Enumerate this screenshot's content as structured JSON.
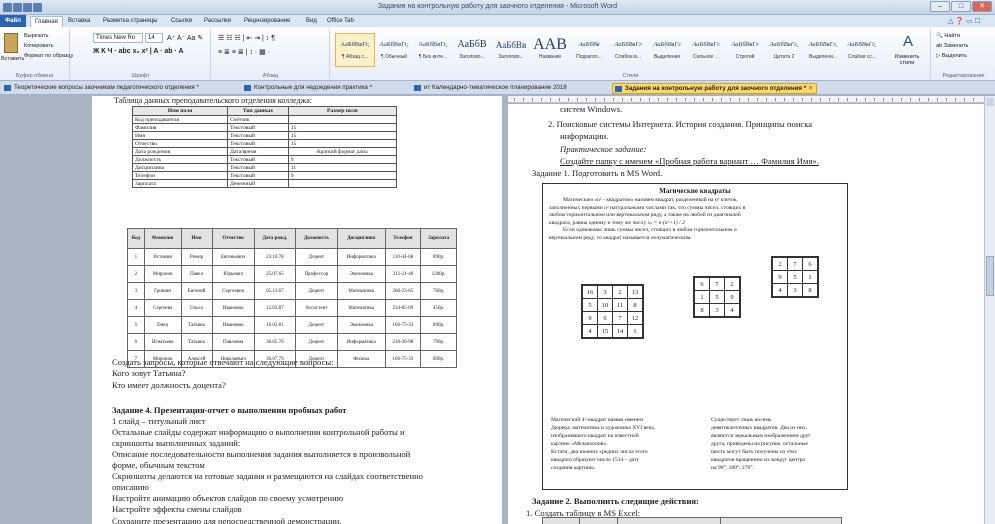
{
  "window": {
    "title": "Задания на контрольную работу для заочного отделения - Microsoft Word"
  },
  "ribbon_tabs": [
    "Файл",
    "Главная",
    "Вставка",
    "Разметка страницы",
    "Ссылки",
    "Рассылки",
    "Рецензирование",
    "Вид",
    "Office Tab"
  ],
  "clipboard": {
    "cut": "Вырезать",
    "copy": "Копировать",
    "paste": "Вставить",
    "format": "Формат по образцу",
    "group": "Буфер обмена"
  },
  "font": {
    "name": "Times New Ro",
    "size": "14",
    "group": "Шрифт"
  },
  "paragraph": {
    "group": "Абзац"
  },
  "styles": {
    "group": "Стили",
    "items": [
      {
        "sample": "АаБбВвГг,",
        "name": "¶ Абзац с..."
      },
      {
        "sample": "АаБбВвГг,",
        "name": "¶ Обычный"
      },
      {
        "sample": "АаБбВвГг,",
        "name": "¶ Без инте..."
      },
      {
        "sample": "АаБбВ",
        "name": "Заголово..."
      },
      {
        "sample": "АаБбВв",
        "name": "Заголово..."
      },
      {
        "sample": "ААВ",
        "name": "Название"
      },
      {
        "sample": "АаБбВв",
        "name": "Подзагол..."
      },
      {
        "sample": "АаБбВвГг",
        "name": "Слабое в..."
      },
      {
        "sample": "АаБбВвГг",
        "name": "Выделение"
      },
      {
        "sample": "АаБбВвГг",
        "name": "Сильное ..."
      },
      {
        "sample": "АаБбВвГг",
        "name": "Строгий"
      },
      {
        "sample": "АаБбВвГг,",
        "name": "Цитата 2"
      },
      {
        "sample": "АаБбВвГг,",
        "name": "Выделени..."
      },
      {
        "sample": "АаБбВвГг,",
        "name": "Слабая сс..."
      }
    ],
    "change": "Изменить стили"
  },
  "editing": {
    "find": "Найти",
    "replace": "Заменить",
    "select": "Выделить",
    "group": "Редактирование"
  },
  "doc_tabs": [
    {
      "label": "Теоретические вопросы заочникам педагогического отделения *",
      "active": false
    },
    {
      "label": "Контрольные для недоедения практика *",
      "active": false
    },
    {
      "label": "ит Календарно-тематическое планирование 2018",
      "active": false
    },
    {
      "label": "Задания на контрольную работу для заочного отделения *",
      "active": true
    }
  ],
  "left_page": {
    "caption": "Таблица данных преподавательского отделения колледжа:",
    "fields_header": [
      "Имя поля",
      "Тип данных",
      "Размер поля"
    ],
    "fields": [
      [
        "Код преподавателя",
        "Счетчик",
        ""
      ],
      [
        "Фамилия",
        "Текстовый",
        "15"
      ],
      [
        "Имя",
        "Текстовый",
        "15"
      ],
      [
        "Отчество",
        "Текстовый",
        "15"
      ],
      [
        "Дата рождения",
        "Дата/время",
        "Краткий формат даты"
      ],
      [
        "Должность",
        "Текстовый",
        "9"
      ],
      [
        "Дисциплина",
        "Текстовый",
        "11"
      ],
      [
        "Телефон",
        "Текстовый",
        "9"
      ],
      [
        "Зарплата",
        "Денежный",
        ""
      ]
    ],
    "data_header": [
      "Код",
      "Фамилия",
      "Имя",
      "Отчество",
      "Дата рожд.",
      "Должность",
      "Дисциплина",
      "Телефон",
      "Зарплата"
    ],
    "data_rows": [
      [
        "1",
        "Истомин",
        "Ремир",
        "Евгеньевич",
        "23.10.78",
        "Доцент",
        "Информатика",
        "110-44-68",
        "890р."
      ],
      [
        "2",
        "Миронов",
        "Павел",
        "Юрьевич",
        "25.07.65",
        "Профессор",
        "Экономика",
        "312-21-40",
        "1200р."
      ],
      [
        "3",
        "Гришин",
        "Евгений",
        "Сергеевич",
        "05.12.67",
        "Доцент",
        "Математика",
        "260-23-65",
        "760р."
      ],
      [
        "4",
        "Сергеева",
        "Ольга",
        "Ивановна",
        "12.02.87",
        "Ассистент",
        "Математика",
        "234-85-69",
        "450р."
      ],
      [
        "5",
        "Емец",
        "Татьяна",
        "Ивановна",
        "16.02.81",
        "Доцент",
        "Экономика",
        "166-75-33",
        "890р."
      ],
      [
        "6",
        "Игнатьева",
        "Татьяна",
        "Павловна",
        "30.05.76",
        "Доцент",
        "Информатика",
        "210-36-98",
        "790р."
      ],
      [
        "7",
        "Миронов",
        "Алексей",
        "Николаевич",
        "30.07.79",
        "Доцент",
        "Физика",
        "166-75-33",
        "890р."
      ]
    ],
    "lines": [
      "Создать запросы, которые отвечают на следующие вопросы:",
      "Кого зовут Татьяна?",
      "Кто имеет должность доцента?",
      "Задание 4. Презентация-отчет о выполнении пробных работ",
      "1 слайд – титульный лист",
      "Остальные слайды содержат информацию о выполнении контрольной работы и",
      "скриншоты выполненных заданий:",
      "Описание последовательности выполнения задания выполняется в произвольной",
      "форме, обычным текстом",
      "Скриншоты делаются на готовые задания и размещаются на слайдах соответственно",
      "описанию",
      "Настройте анимацию объектов слайдов по своему усмотрению",
      "Настройте эффекты смены слайдов",
      "Сохраните презентацию для непосредственной демонстрации."
    ]
  },
  "right_page": {
    "lines": [
      "систем Windows.",
      "2.  Поисковые системы Интернета. История создания. Принципы поиска",
      "информации.",
      "Практическое задание:",
      "Создайте папку с именем «Пробная работа вариант … Фамилия Имя».",
      "Задание 1. Подготовить в MS Word."
    ],
    "box": {
      "title": "Магические квадраты",
      "p1": "Магическим «n² - квадратом» назовем квадрат, разделенный на n² клеток,",
      "p2": "заполненных первыми n² натуральными числами так, что суммы чисел, стоящих в",
      "p3": "любом горизонтальном или вертикальном ряду, а также на любой из диагоналей",
      "p4": "квадрата, равны одному и тому же числу",
      "formula": "sₙ = n·(n²+1) / 2",
      "p5": "Если одинаковы лишь суммы чисел, стоящих в любом горизонтальном и",
      "p6": "вертикальном ряду, то квадрат называется полумагическим.",
      "sq4": [
        [
          "16",
          "3",
          "2",
          "13"
        ],
        [
          "5",
          "10",
          "11",
          "8"
        ],
        [
          "9",
          "6",
          "7",
          "12"
        ],
        [
          "4",
          "15",
          "14",
          "1"
        ]
      ],
      "sq3a": [
        [
          "6",
          "7",
          "2"
        ],
        [
          "1",
          "5",
          "9"
        ],
        [
          "8",
          "3",
          "4"
        ]
      ],
      "sq3b": [
        [
          "2",
          "7",
          "6"
        ],
        [
          "9",
          "5",
          "1"
        ],
        [
          "4",
          "3",
          "8"
        ]
      ],
      "left_text": [
        "Магический 4²-квадрат назван именем",
        "Дюрера, математика и художника XVI века,",
        "изобразившего квадрат на известной",
        "картине «Меланхолия».",
        "Кстати, два нижних средних числа этого",
        "квадрата образуют число 1514 – дату",
        "создания картины."
      ],
      "right_text": [
        "Существует лишь восемь",
        "девятиклеточных квадратов. Два из них,",
        "являются зеркальным изображением друг",
        "друга, приведены на рисунке, остальные",
        "шесть могут быть получены из этих",
        "квадратов вращением их вокруг центра",
        "на 90°, 180°, 270°."
      ]
    },
    "task2": "Задание 2. Выполнить следящие действия:",
    "task2_1": "1.  Создать таблицу в MS Excel:",
    "excel_header": [
      "Номер",
      "Кол-во",
      "Плановая стоимость",
      "Нормативная стоимость"
    ]
  },
  "colors": {
    "active_tab": "#ffd96a",
    "accent": "#2a63b2"
  }
}
